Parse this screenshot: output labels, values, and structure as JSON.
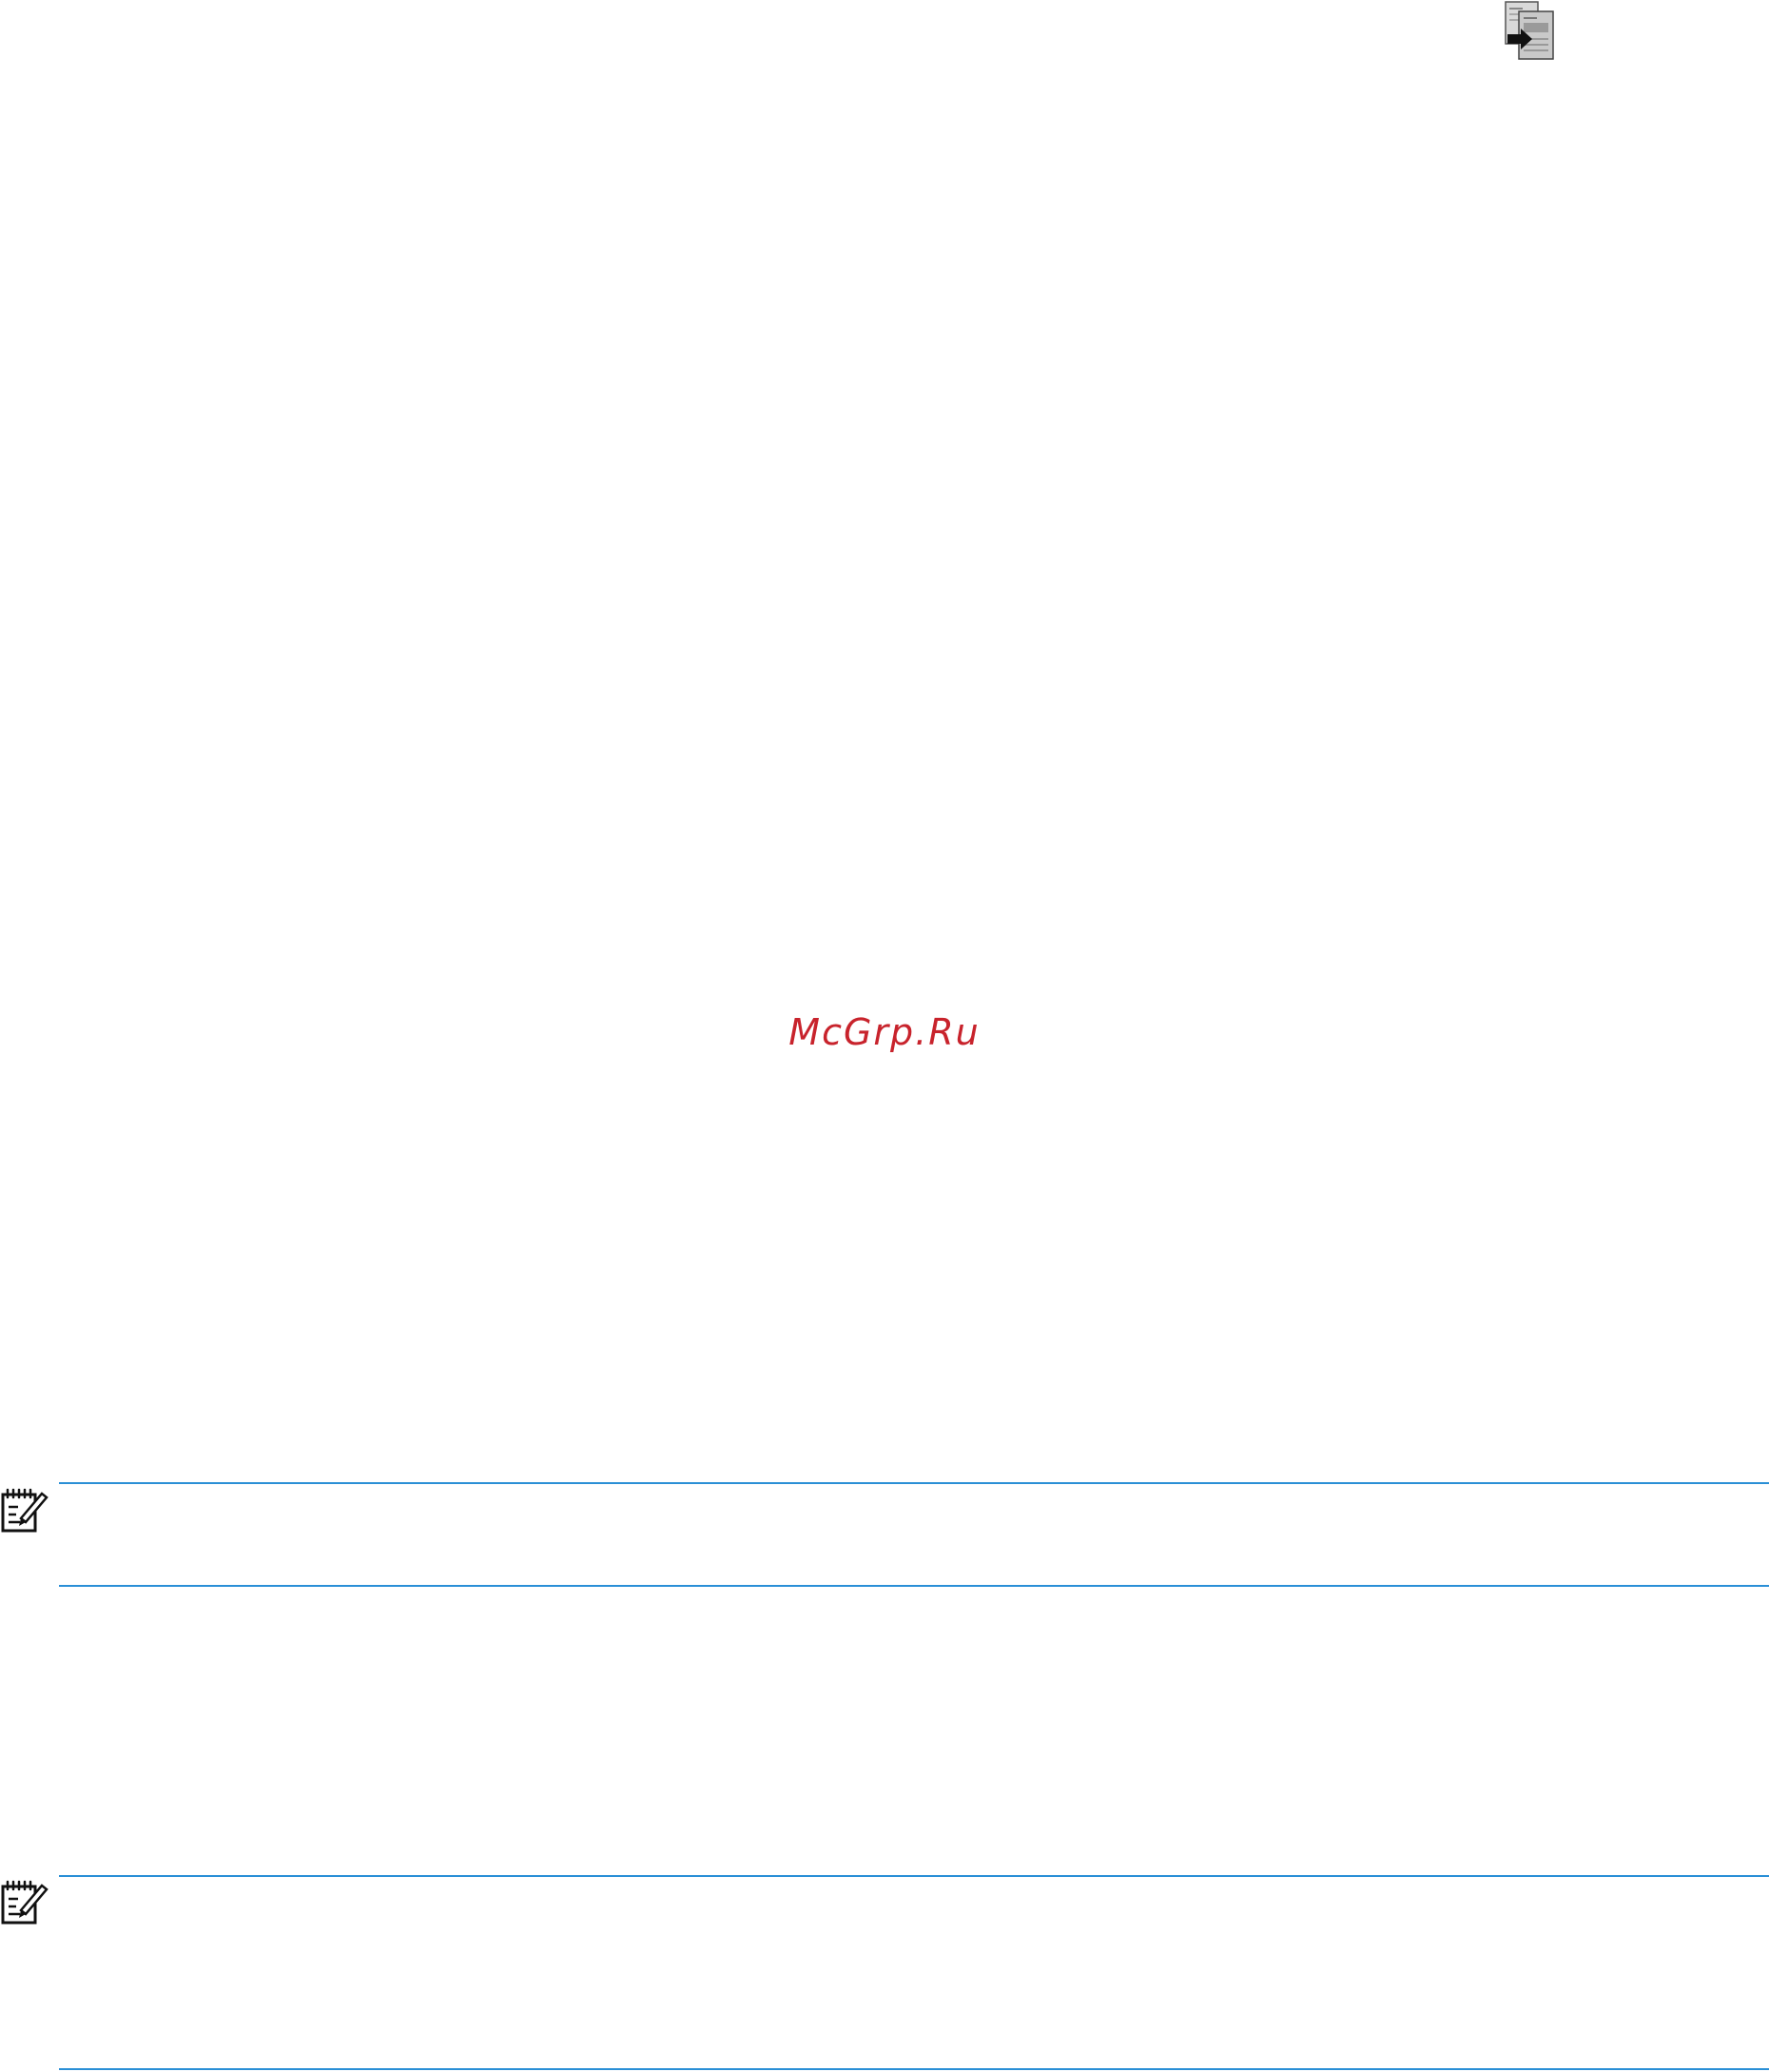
{
  "watermark": {
    "text": "McGrp.Ru",
    "color": "#c8232c"
  },
  "icons": {
    "copy_document": "copy-document-arrow-icon",
    "note": "note-pencil-icon"
  },
  "colors": {
    "rule": "#2a8fd6",
    "icon_dark": "#1a1a1a",
    "icon_gray": "#b5b5b5"
  }
}
